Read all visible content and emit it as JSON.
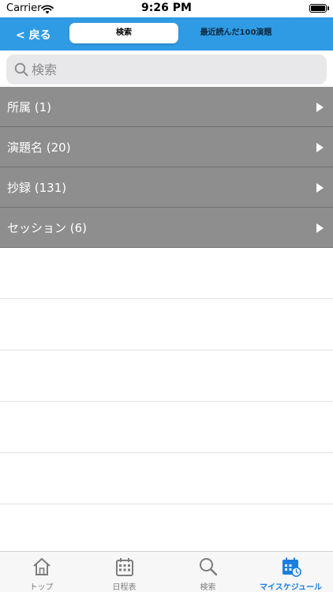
{
  "status_bar": {
    "carrier": "Carrier",
    "time": "9:26 PM"
  },
  "nav": {
    "back_label": "< 戻る",
    "segments": [
      {
        "label": "検索",
        "selected": true
      },
      {
        "label": "最近読んだ100演題",
        "selected": false
      }
    ]
  },
  "search": {
    "placeholder": "検索",
    "value": ""
  },
  "categories": [
    {
      "label": "所属 (1)"
    },
    {
      "label": "演題名 (20)"
    },
    {
      "label": "抄録 (131)"
    },
    {
      "label": "セッション (6)"
    }
  ],
  "tabs": [
    {
      "label": "トップ",
      "icon": "home-icon",
      "selected": false
    },
    {
      "label": "日程表",
      "icon": "calendar-grid-icon",
      "selected": false
    },
    {
      "label": "検索",
      "icon": "search-icon",
      "selected": false
    },
    {
      "label": "マイスケジュール",
      "icon": "calendar-clock-icon",
      "selected": true
    }
  ],
  "colors": {
    "nav_background": "#2f9be4",
    "row_background": "#8e8e8e",
    "tab_selected": "#1a7fe0",
    "tab_unselected": "#7d7d7d"
  }
}
